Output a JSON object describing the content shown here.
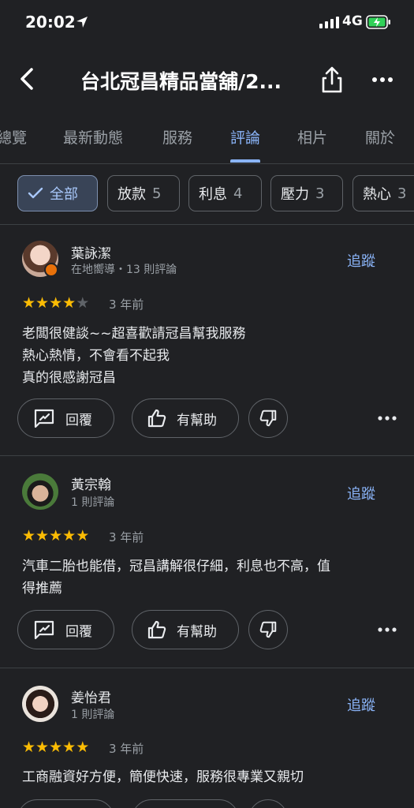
{
  "status_bar": {
    "time": "20:02",
    "network": "4G"
  },
  "header": {
    "title": "台北冠昌精品當舖/2..."
  },
  "tabs": [
    {
      "label": "總覽"
    },
    {
      "label": "最新動態"
    },
    {
      "label": "服務"
    },
    {
      "label": "評論",
      "active": true
    },
    {
      "label": "相片"
    },
    {
      "label": "關於"
    }
  ],
  "filters": [
    {
      "label": "全部",
      "selected": true
    },
    {
      "label": "放款",
      "count": "5"
    },
    {
      "label": "利息",
      "count": "4"
    },
    {
      "label": "壓力",
      "count": "3"
    },
    {
      "label": "熱心",
      "count": "3"
    }
  ],
  "actions": {
    "reply": "回覆",
    "helpful": "有幫助",
    "follow": "追蹤"
  },
  "reviews": [
    {
      "name": "葉詠潔",
      "meta": "在地嚮導・13 則評論",
      "rating": 4,
      "time": "3 年前",
      "text": [
        "老闆很健談~~超喜歡請冠昌幫我服務",
        "熱心熱情，不會看不起我",
        "真的很感謝冠昌"
      ]
    },
    {
      "name": "黃宗翰",
      "meta": "1 則評論",
      "rating": 5,
      "time": "3 年前",
      "text": [
        "汽車二胎也能借，冠昌講解很仔細，利息也不高，值",
        "得推薦"
      ]
    },
    {
      "name": "姜怡君",
      "meta": "1 則評論",
      "rating": 5,
      "time": "3 年前",
      "text": [
        "工商融資好方便，簡便快速，服務很專業又親切"
      ]
    }
  ],
  "colors": {
    "background": "#202124",
    "accent": "#8ab4f8",
    "star": "#fbbc04"
  }
}
